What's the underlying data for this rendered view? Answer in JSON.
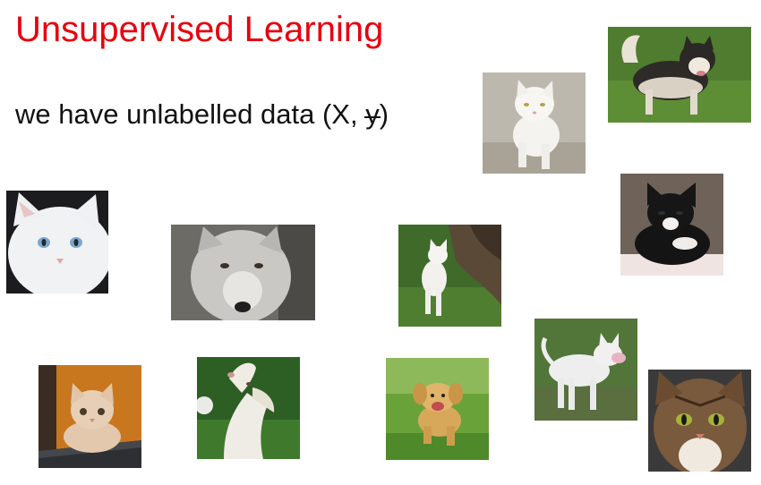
{
  "slide": {
    "title": "Unsupervised Learning",
    "subtitle_prefix": "we have unlabelled data (X, ",
    "subtitle_struck": "y",
    "subtitle_suffix": ")",
    "title_color": "#e8000d"
  },
  "photos": [
    {
      "id": "cat-white-standing",
      "subject": "white cat standing"
    },
    {
      "id": "dog-husky",
      "subject": "husky dog on grass"
    },
    {
      "id": "cat-white-fluffy",
      "subject": "fluffy white cat with blue eyes"
    },
    {
      "id": "wolf-gray",
      "subject": "gray wolf face"
    },
    {
      "id": "cat-white-tree",
      "subject": "white cat by a tree trunk"
    },
    {
      "id": "kitten-black-white",
      "subject": "black and white kitten"
    },
    {
      "id": "cat-white-bull-terrier",
      "subject": "white bull terrier on grass"
    },
    {
      "id": "kitten-on-laptop",
      "subject": "cream kitten on a laptop"
    },
    {
      "id": "dog-white-looking-up",
      "subject": "white dog looking up"
    },
    {
      "id": "puppy-golden-running",
      "subject": "golden puppy running"
    },
    {
      "id": "cat-tabby-green-eyes",
      "subject": "tabby cat with green eyes"
    }
  ]
}
